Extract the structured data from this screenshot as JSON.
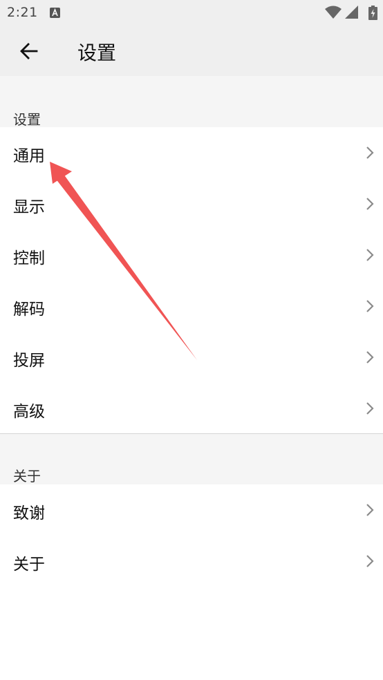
{
  "status_bar": {
    "time": "2:21",
    "icons": [
      "notification-a-icon",
      "wifi-icon",
      "signal-icon",
      "battery-charging-icon"
    ]
  },
  "toolbar": {
    "back_icon": "arrow-left-icon",
    "title": "设置"
  },
  "sections": [
    {
      "header": "设置",
      "items": [
        "通用",
        "显示",
        "控制",
        "解码",
        "投屏",
        "高级"
      ]
    },
    {
      "header": "关于",
      "items": [
        "致谢",
        "关于"
      ]
    }
  ],
  "colors": {
    "bar_background": "#efefef",
    "section_background": "#f5f5f5",
    "annotation_arrow": "#f05454",
    "chevron": "#8a8a8a"
  }
}
